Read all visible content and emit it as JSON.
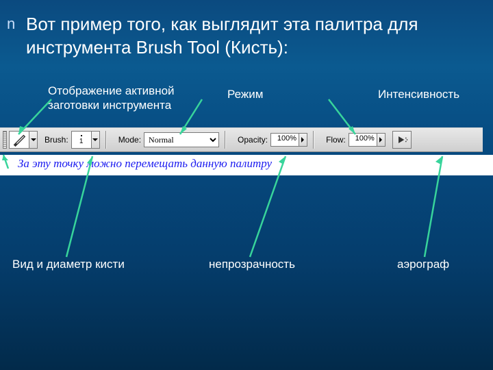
{
  "bullet": "n",
  "title": "Вот пример того, как выглядит эта палитра для инструмента Brush Tool (Кисть):",
  "labels": {
    "preset": "Отображение активной\nзаготовки инструмента",
    "mode": "Режим",
    "intensity": "Интенсивность",
    "brush": "Вид и диаметр кисти",
    "opacity": "непрозрачность",
    "airbrush": "аэрограф"
  },
  "toolbar": {
    "brush_label": "Brush:",
    "brush_size": "1",
    "mode_label": "Mode:",
    "mode_value": "Normal",
    "opacity_label": "Opacity:",
    "opacity_value": "100%",
    "flow_label": "Flow:",
    "flow_value": "100%"
  },
  "caption": "За эту точку можно перемещать данную палитру"
}
